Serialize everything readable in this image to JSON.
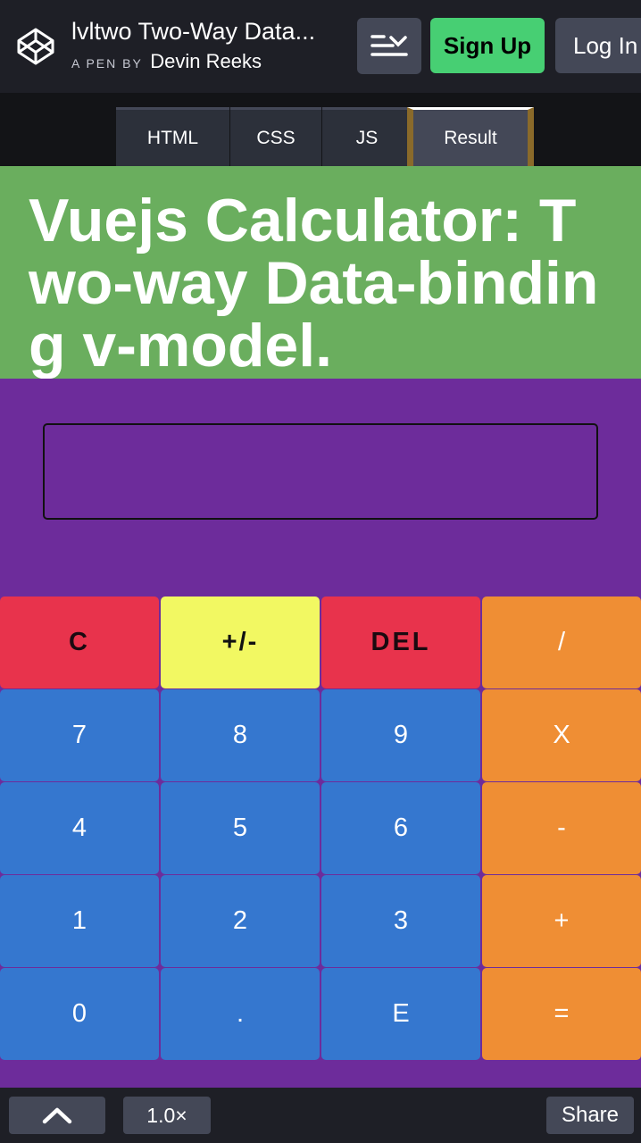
{
  "header": {
    "pen_title": "lvltwo Two-Way Data...",
    "pen_by_label": "A PEN BY",
    "author": "Devin Reeks",
    "signup_label": "Sign Up",
    "login_label": "Log In"
  },
  "tabs": [
    {
      "label": "HTML"
    },
    {
      "label": "CSS"
    },
    {
      "label": "JS"
    },
    {
      "label": "Result",
      "active": true
    }
  ],
  "result": {
    "heading": "Vuejs Calculator: Two-way Data-binding v-model.",
    "display_value": "",
    "keys": {
      "clear": "C",
      "sign": "+/-",
      "del": "DEL",
      "divide": "/",
      "k7": "7",
      "k8": "8",
      "k9": "9",
      "multiply": "X",
      "k4": "4",
      "k5": "5",
      "k6": "6",
      "minus": "-",
      "k1": "1",
      "k2": "2",
      "k3": "3",
      "plus": "+",
      "k0": "0",
      "dot": ".",
      "e": "E",
      "equals": "="
    }
  },
  "footer": {
    "zoom": "1.0×",
    "share_label": "Share"
  },
  "colors": {
    "header_bg": "#1e1f26",
    "signup": "#47cf73",
    "heading_bg": "#6aae5e",
    "calc_bg": "#6d2c9b",
    "key_red": "#e8334c",
    "key_yellow": "#f2f862",
    "key_orange": "#ef8e34",
    "key_blue": "#3577cf"
  },
  "icons": {
    "logo": "codepen-logo-icon",
    "menu": "menu-chevron-icon",
    "up": "chevron-up-icon"
  }
}
